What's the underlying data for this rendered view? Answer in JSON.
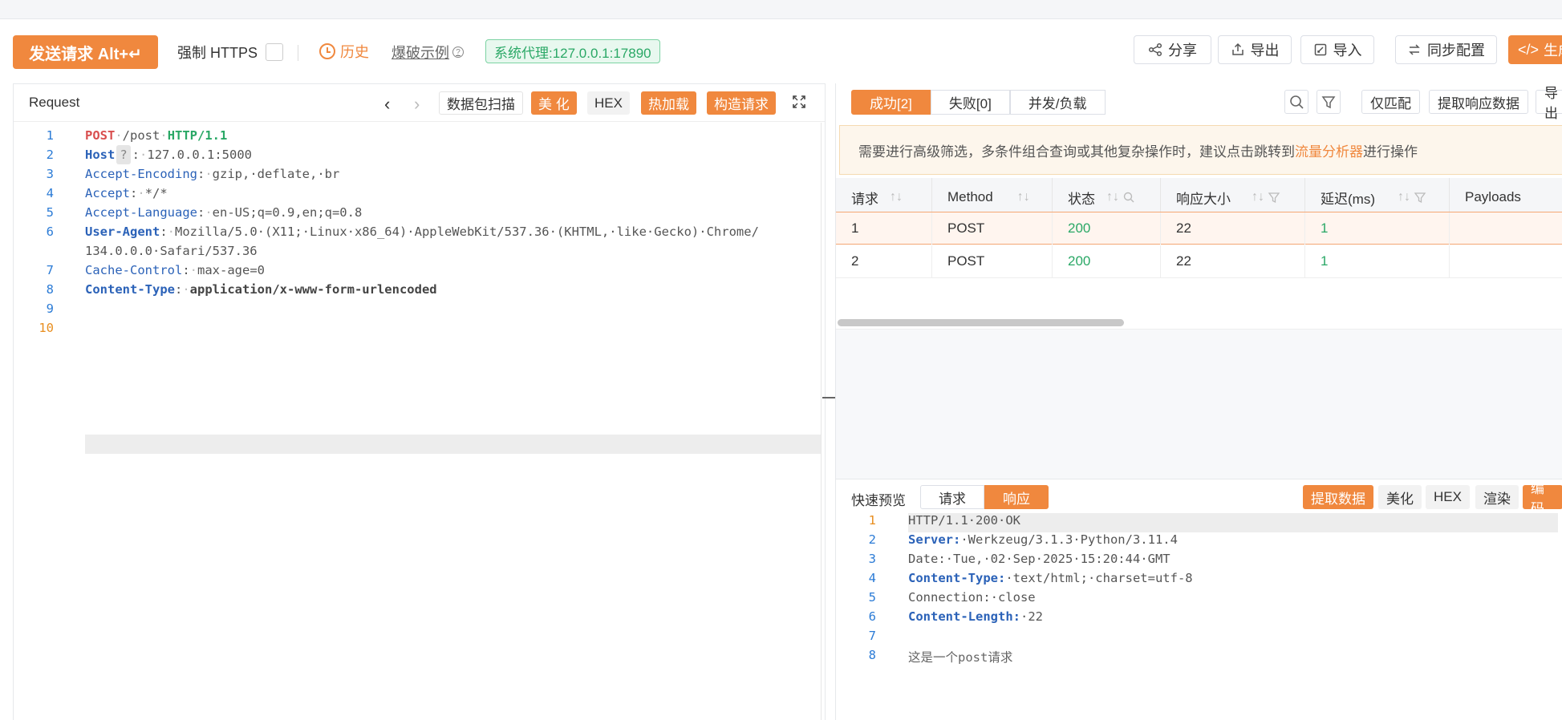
{
  "toolbar": {
    "send_label": "发送请求 Alt+↵",
    "force_https_label": "强制 HTTPS",
    "history_label": "历史",
    "examples_label": "爆破示例",
    "proxy_label": "系统代理:127.0.0.1:17890",
    "share_label": "分享",
    "export_label": "导出",
    "import_label": "导入",
    "sync_label": "同步配置",
    "generate_label": "生成"
  },
  "request": {
    "title": "Request",
    "buttons": {
      "scan": "数据包扫描",
      "beautify": "美 化",
      "hex": "HEX",
      "hotload": "热加载",
      "build": "构造请求"
    },
    "lines": {
      "l1": {
        "method": "POST",
        "path": "/post",
        "proto": "HTTP/1.1"
      },
      "l2": {
        "key": "Host",
        "qmark": "?",
        "value": "127.0.0.1:5000"
      },
      "l3": {
        "key": "Accept-Encoding",
        "value": "gzip,·deflate,·br"
      },
      "l4": {
        "key": "Accept",
        "value": "*/*"
      },
      "l5": {
        "key": "Accept-Language",
        "value": "en-US;q=0.9,en;q=0.8"
      },
      "l6": {
        "key": "User-Agent",
        "value": "Mozilla/5.0·(X11;·Linux·x86_64)·AppleWebKit/537.36·(KHTML,·like·Gecko)·Chrome/",
        "wrap": "134.0.0.0·Safari/537.36"
      },
      "l7": {
        "key": "Cache-Control",
        "value": "max-age=0"
      },
      "l8": {
        "key": "Content-Type",
        "value": "application/x-www-form-urlencoded"
      }
    },
    "line_numbers": [
      "1",
      "2",
      "3",
      "4",
      "5",
      "6",
      "7",
      "8",
      "9",
      "10"
    ]
  },
  "results": {
    "tabs": {
      "success": "成功[2]",
      "fail": "失败[0]",
      "concurrency": "并发/负载"
    },
    "buttons": {
      "match_only": "仅匹配",
      "extract": "提取响应数据",
      "export": "导出"
    },
    "notice": {
      "prefix": "需要进行高级筛选，多条件组合查询或其他复杂操作时，建议点击跳转到",
      "link": "流量分析器",
      "suffix": "进行操作"
    },
    "columns": {
      "req": "请求",
      "method": "Method",
      "status": "状态",
      "size": "响应大小",
      "delay": "延迟(ms)",
      "payloads": "Payloads"
    },
    "rows": [
      {
        "req": "1",
        "method": "POST",
        "status": "200",
        "size": "22",
        "delay": "1",
        "payloads": ""
      },
      {
        "req": "2",
        "method": "POST",
        "status": "200",
        "size": "22",
        "delay": "1",
        "payloads": ""
      }
    ]
  },
  "preview": {
    "label": "快速预览",
    "tab_request": "请求",
    "tab_response": "响应",
    "buttons": {
      "extract": "提取数据",
      "beautify": "美化",
      "hex": "HEX",
      "render": "渲染",
      "encode": "编码"
    },
    "line_numbers": [
      "1",
      "2",
      "3",
      "4",
      "5",
      "6",
      "7",
      "8"
    ],
    "lines": {
      "l1": "HTTP/1.1·200·OK",
      "l2": {
        "key": "Server:",
        "value": "·Werkzeug/3.1.3·Python/3.11.4"
      },
      "l3": "Date:·Tue,·02·Sep·2025·15:20:44·GMT",
      "l4": {
        "key": "Content-Type:",
        "value": "·text/html;·charset=utf-8"
      },
      "l5": "Connection:·close",
      "l6": {
        "key": "Content-Length:",
        "value": "·22"
      },
      "l8": "这是一个post请求"
    }
  },
  "colors": {
    "accent": "#f0883e",
    "success": "#2aa866",
    "link_blue": "#2b62b8"
  }
}
